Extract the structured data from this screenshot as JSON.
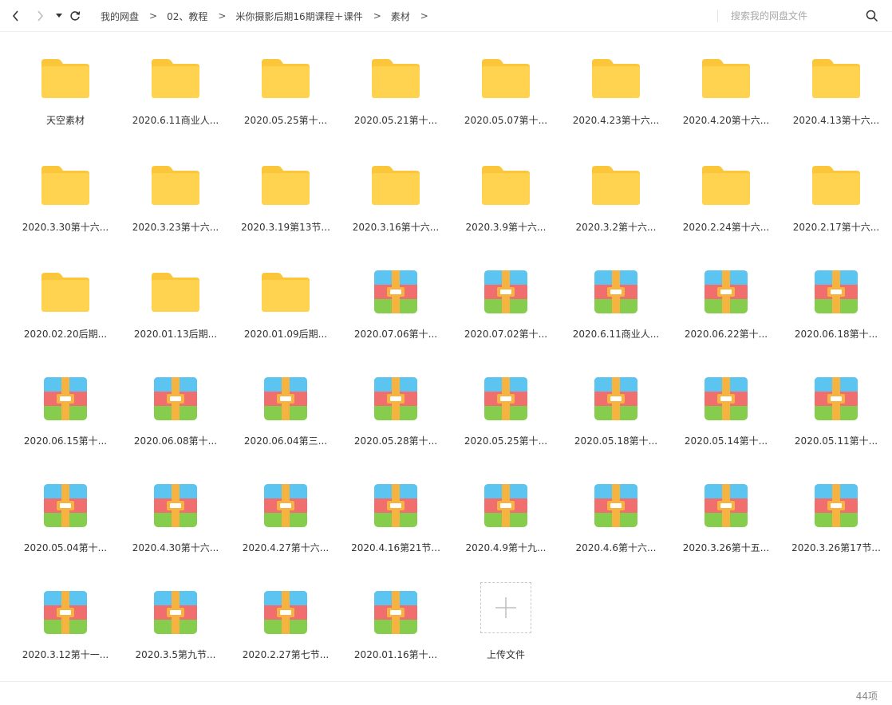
{
  "toolbar": {
    "breadcrumb": [
      "我的网盘",
      "02、教程",
      "米你摄影后期16期课程＋课件",
      "素材"
    ],
    "separator": ">",
    "search_placeholder": "搜索我的网盘文件"
  },
  "colors": {
    "folder": "#ffd34f",
    "folder_tab": "#fcc63a"
  },
  "items": [
    {
      "name": "天空素材",
      "type": "folder"
    },
    {
      "name": "2020.6.11商业人...",
      "type": "folder"
    },
    {
      "name": "2020.05.25第十...",
      "type": "folder"
    },
    {
      "name": "2020.05.21第十...",
      "type": "folder"
    },
    {
      "name": "2020.05.07第十...",
      "type": "folder"
    },
    {
      "name": "2020.4.23第十六...",
      "type": "folder"
    },
    {
      "name": "2020.4.20第十六...",
      "type": "folder"
    },
    {
      "name": "2020.4.13第十六...",
      "type": "folder"
    },
    {
      "name": "2020.3.30第十六...",
      "type": "folder"
    },
    {
      "name": "2020.3.23第十六...",
      "type": "folder"
    },
    {
      "name": "2020.3.19第13节...",
      "type": "folder"
    },
    {
      "name": "2020.3.16第十六...",
      "type": "folder"
    },
    {
      "name": "2020.3.9第十六...",
      "type": "folder"
    },
    {
      "name": "2020.3.2第十六...",
      "type": "folder"
    },
    {
      "name": "2020.2.24第十六...",
      "type": "folder"
    },
    {
      "name": "2020.2.17第十六...",
      "type": "folder"
    },
    {
      "name": "2020.02.20后期...",
      "type": "folder"
    },
    {
      "name": "2020.01.13后期...",
      "type": "folder"
    },
    {
      "name": "2020.01.09后期...",
      "type": "folder"
    },
    {
      "name": "2020.07.06第十...",
      "type": "archive"
    },
    {
      "name": "2020.07.02第十...",
      "type": "archive"
    },
    {
      "name": "2020.6.11商业人...",
      "type": "archive"
    },
    {
      "name": "2020.06.22第十...",
      "type": "archive"
    },
    {
      "name": "2020.06.18第十...",
      "type": "archive"
    },
    {
      "name": "2020.06.15第十...",
      "type": "archive"
    },
    {
      "name": "2020.06.08第十...",
      "type": "archive"
    },
    {
      "name": "2020.06.04第三...",
      "type": "archive"
    },
    {
      "name": "2020.05.28第十...",
      "type": "archive"
    },
    {
      "name": "2020.05.25第十...",
      "type": "archive"
    },
    {
      "name": "2020.05.18第十...",
      "type": "archive"
    },
    {
      "name": "2020.05.14第十...",
      "type": "archive"
    },
    {
      "name": "2020.05.11第十...",
      "type": "archive"
    },
    {
      "name": "2020.05.04第十...",
      "type": "archive"
    },
    {
      "name": "2020.4.30第十六...",
      "type": "archive"
    },
    {
      "name": "2020.4.27第十六...",
      "type": "archive"
    },
    {
      "name": "2020.4.16第21节...",
      "type": "archive"
    },
    {
      "name": "2020.4.9第十九...",
      "type": "archive"
    },
    {
      "name": "2020.4.6第十六...",
      "type": "archive"
    },
    {
      "name": "2020.3.26第十五...",
      "type": "archive"
    },
    {
      "name": "2020.3.26第17节...",
      "type": "archive"
    },
    {
      "name": "2020.3.12第十一...",
      "type": "archive"
    },
    {
      "name": "2020.3.5第九节...",
      "type": "archive"
    },
    {
      "name": "2020.2.27第七节...",
      "type": "archive"
    },
    {
      "name": "2020.01.16第十...",
      "type": "archive"
    }
  ],
  "upload": {
    "label": "上传文件"
  },
  "footer": {
    "count": "44项"
  }
}
